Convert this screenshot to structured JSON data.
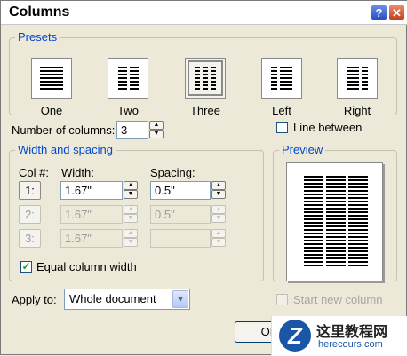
{
  "window": {
    "title": "Columns",
    "help_glyph": "?",
    "close_glyph": "✕"
  },
  "presets": {
    "label": "Presets",
    "items": [
      {
        "label": "One",
        "selected": false
      },
      {
        "label": "Two",
        "selected": false
      },
      {
        "label": "Three",
        "selected": true
      },
      {
        "label": "Left",
        "selected": false
      },
      {
        "label": "Right",
        "selected": false
      }
    ]
  },
  "number_of_columns": {
    "label": "Number of columns:",
    "value": "3"
  },
  "line_between": {
    "label": "Line between",
    "checked": false
  },
  "width_spacing": {
    "label": "Width and spacing",
    "col_header": "Col #:",
    "width_header": "Width:",
    "spacing_header": "Spacing:",
    "rows": [
      {
        "col": "1:",
        "width": "1.67\"",
        "spacing": "0.5\"",
        "enabled": true
      },
      {
        "col": "2:",
        "width": "1.67\"",
        "spacing": "0.5\"",
        "enabled": false
      },
      {
        "col": "3:",
        "width": "1.67\"",
        "spacing": "",
        "enabled": false
      }
    ]
  },
  "equal_column_width": {
    "label": "Equal column width",
    "checked": true,
    "check_glyph": "✓"
  },
  "preview": {
    "label": "Preview"
  },
  "apply_to": {
    "label": "Apply to:",
    "value": "Whole document"
  },
  "start_new_column": {
    "label": "Start new column",
    "checked": false,
    "enabled": false
  },
  "buttons": {
    "ok_label": "OK"
  },
  "watermark": {
    "logo_glyph": "Z",
    "line1": "这里教程网",
    "line2": "herecours.com"
  },
  "colors": {
    "accent": "#0046d5",
    "face": "#ece9d8"
  }
}
